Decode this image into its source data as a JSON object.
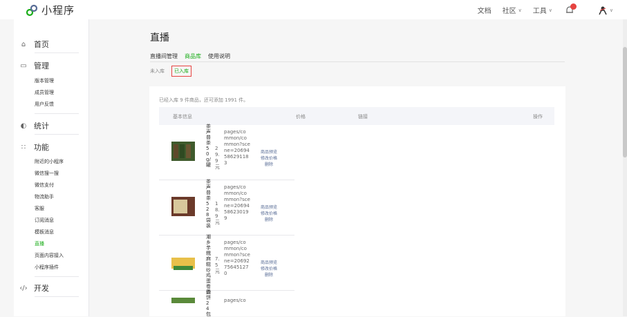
{
  "header": {
    "logo_text": "小程序",
    "nav": [
      {
        "label": "文档",
        "dropdown": false
      },
      {
        "label": "社区",
        "dropdown": true
      },
      {
        "label": "工具",
        "dropdown": true
      }
    ],
    "accent": "#1aad19"
  },
  "sidebar": {
    "groups": {
      "home": "首页",
      "manage": "管理",
      "stats": "统计",
      "features": "功能",
      "dev": "开发"
    },
    "manage_items": [
      "版本管理",
      "成员管理",
      "用户反馈"
    ],
    "feature_items": [
      "附近的小程序",
      "微信搜一搜",
      "微信支付",
      "物流助手",
      "客服",
      "订阅消息",
      "模板消息",
      "直播",
      "页面内容接入",
      "小程序插件"
    ],
    "active_item": "直播"
  },
  "page": {
    "title": "直播",
    "tabs": [
      "直播间管理",
      "商品库",
      "使用说明"
    ],
    "active_tab": "商品库",
    "subtabs": [
      "未入库",
      "已入库"
    ],
    "active_subtab": "已入库",
    "summary": "已经入库 9 件商品，还可添加 1991 件。",
    "columns": {
      "info": "基本信息",
      "price": "价格",
      "link": "链接",
      "ops": "操作"
    }
  },
  "products": [
    {
      "name": "茶声普茶50g/罐",
      "price": "29.9元",
      "link": "pages/common/common?scene=20694586291183",
      "ops": [
        "商品预览",
        "修改价格",
        "删除"
      ]
    },
    {
      "name": "茶声普茶528袋装",
      "price": "18.9元",
      "link": "pages/common/common?scene=20694586230199",
      "ops": [
        "商品预览",
        "修改价格",
        "删除"
      ]
    },
    {
      "name": "潮乡芋糯麻糍纱鸡蛋卷烧饼24包",
      "price": "7.5元",
      "link": "pages/common/common?scene=20692756451270",
      "ops": [
        "商品预览",
        "修改价格",
        "删除"
      ]
    },
    {
      "name": "香",
      "price": "",
      "link": "pages/co",
      "ops": []
    }
  ]
}
